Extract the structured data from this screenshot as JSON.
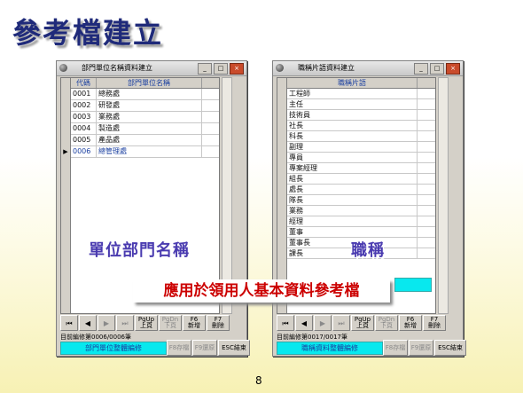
{
  "slide_title": "參考檔建立",
  "page_number": "8",
  "banner_text": "應用於領用人基本資料參考檔",
  "left_label": "單位部門名稱",
  "right_label": "職稱",
  "left_window": {
    "title": "部門單位名稱資料建立",
    "columns": [
      "代碼",
      "部門單位名稱"
    ],
    "rows": [
      [
        "0001",
        "總務處"
      ],
      [
        "0002",
        "研發處"
      ],
      [
        "0003",
        "業務處"
      ],
      [
        "0004",
        "製造處"
      ],
      [
        "0005",
        "產品處"
      ],
      [
        "0006",
        "總管理處"
      ]
    ],
    "selected_row": 5,
    "status": "目前編修第0006/0006筆",
    "footer_label": "部門單位整體編修"
  },
  "right_window": {
    "title": "職稱片語資料建立",
    "columns": [
      "職稱片語"
    ],
    "rows": [
      "工程師",
      "主任",
      "技術員",
      "社長",
      "科長",
      "副理",
      "專員",
      "專案經理",
      "組長",
      "處長",
      "隊長",
      "業務",
      "經理",
      "董事",
      "董事長",
      "課長"
    ],
    "status": "目前編修第0017/0017筆",
    "footer_label": "職稱資料整體編修"
  },
  "nav": {
    "first": "⏮",
    "prev": "◀",
    "next": "▶",
    "last": "⏭",
    "pgup_key": "PgUp",
    "pgup_label": "上頁",
    "pgdn_key": "PgDn",
    "pgdn_label": "下頁",
    "f6_key": "F6",
    "f6_label": "新增",
    "f7_key": "F7",
    "f7_label": "刪除",
    "f8_label": "F8存檔",
    "f9_label": "F9還原",
    "esc_label": "ESC結束"
  },
  "titlebar_buttons": [
    "_",
    "□",
    "×"
  ]
}
